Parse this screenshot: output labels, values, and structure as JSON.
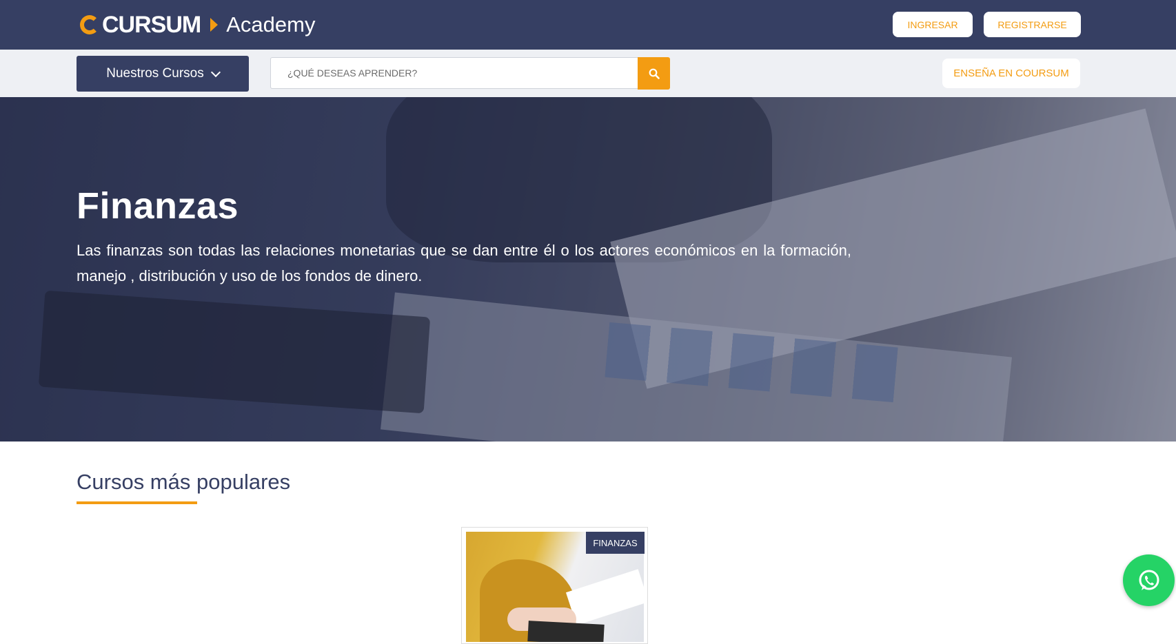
{
  "header": {
    "logo_text": "CURSUM",
    "logo_suffix": "Academy",
    "login_label": "INGRESAR",
    "register_label": "REGISTRARSE"
  },
  "subbar": {
    "courses_label": "Nuestros Cursos",
    "search_placeholder": "¿QUÉ DESEAS APRENDER?",
    "teach_label": "ENSEÑA EN COURSUM"
  },
  "hero": {
    "title": "Finanzas",
    "description": "Las finanzas son todas las relaciones monetarias que se dan entre él o los actores económicos en la formación, manejo , distribución y uso de los fondos de dinero."
  },
  "popular": {
    "title": "Cursos más populares",
    "courses": [
      {
        "category": "FINANZAS"
      }
    ]
  },
  "icons": {
    "search": "search-icon",
    "chevron": "chevron-down-icon",
    "whatsapp": "whatsapp-icon"
  },
  "colors": {
    "primary": "#363f63",
    "accent": "#f39c12",
    "whatsapp": "#25d366"
  }
}
